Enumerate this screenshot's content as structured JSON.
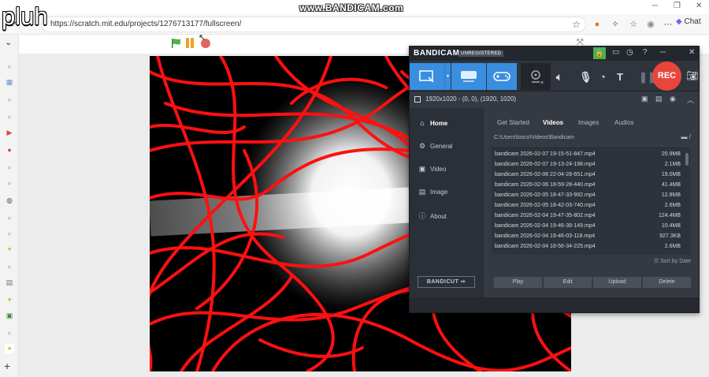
{
  "overlay": {
    "title": "pluh",
    "watermark": "www.BANDICAM.com"
  },
  "browser": {
    "url": "https://scratch.mit.edu/projects/1276713177/fullscreen/",
    "chat_label": "Chat"
  },
  "bandicam": {
    "logo": "BANDICAM",
    "unregistered": "UNREGISTERED",
    "rec_label": "REC",
    "resolution_info": "1920x1020 - (0, 0), (1920, 1020)",
    "nav": [
      "Home",
      "General",
      "Video",
      "Image",
      "About"
    ],
    "tabs": [
      "Get Started",
      "Videos",
      "Images",
      "Audios"
    ],
    "active_tab": "Videos",
    "path": "C:\\Users\\losco\\Videos\\Bandicam",
    "files": [
      {
        "name": "bandicam 2026-02-07 19-15-51-847.mp4",
        "size": "20.9MB"
      },
      {
        "name": "bandicam 2026-02-07 19-13-24-198.mp4",
        "size": "2.1MB"
      },
      {
        "name": "bandicam 2026-02-06 22-04-28-651.mp4",
        "size": "19.0MB"
      },
      {
        "name": "bandicam 2026-02-06 18-59-28-440.mp4",
        "size": "41.4MB"
      },
      {
        "name": "bandicam 2026-02-05 18-47-33-992.mp4",
        "size": "12.8MB"
      },
      {
        "name": "bandicam 2026-02-05 18-42-03-740.mp4",
        "size": "2.6MB"
      },
      {
        "name": "bandicam 2026-02-04 19-47-35-802.mp4",
        "size": "124.4MB"
      },
      {
        "name": "bandicam 2026-02-04 19-46-38-149.mp4",
        "size": "10.4MB"
      },
      {
        "name": "bandicam 2026-02-04 19-46-03-118.mp4",
        "size": "927.3KB"
      },
      {
        "name": "bandicam 2026-02-04 18-56-34-225.mp4",
        "size": "2.6MB"
      }
    ],
    "sort_label": "Sort by Date",
    "actions": [
      "Play",
      "Edit",
      "Upload",
      "Delete"
    ],
    "bandicut": "BANDICUT",
    "colors": {
      "accent": "#3a8ee0",
      "rec": "#e8463c",
      "lock": "#4caf50"
    }
  }
}
